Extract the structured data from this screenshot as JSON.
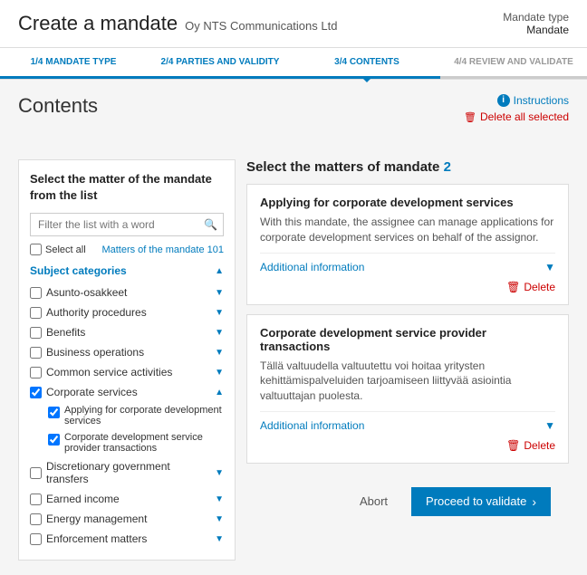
{
  "header": {
    "title": "Create a mandate",
    "company": "Oy NTS Communications Ltd",
    "mandate_type_label": "Mandate type",
    "mandate_type_value": "Mandate"
  },
  "progress": {
    "steps": [
      {
        "id": "step1",
        "label": "1/4 MANDATE TYPE",
        "state": "done"
      },
      {
        "id": "step2",
        "label": "2/4 PARTIES AND VALIDITY",
        "state": "done"
      },
      {
        "id": "step3",
        "label": "3/4 CONTENTS",
        "state": "active"
      },
      {
        "id": "step4",
        "label": "4/4 REVIEW AND VALIDATE",
        "state": "inactive"
      }
    ]
  },
  "page": {
    "title": "Contents",
    "instructions_label": "Instructions",
    "delete_all_label": "Delete all selected"
  },
  "left_panel": {
    "title": "Select the matter of the mandate from the list",
    "search_placeholder": "Filter the list with a word",
    "select_all_label": "Select all",
    "matters_label": "Matters of the mandate",
    "matters_count": "101",
    "subject_categories_label": "Subject categories",
    "items": [
      {
        "id": "asunto",
        "label": "Asunto-osakkeet",
        "checked": false,
        "expanded": false
      },
      {
        "id": "authority",
        "label": "Authority procedures",
        "checked": false,
        "expanded": false
      },
      {
        "id": "benefits",
        "label": "Benefits",
        "checked": false,
        "expanded": false
      },
      {
        "id": "business",
        "label": "Business operations",
        "checked": false,
        "expanded": false
      },
      {
        "id": "common",
        "label": "Common service activities",
        "checked": false,
        "expanded": false
      },
      {
        "id": "corporate",
        "label": "Corporate services",
        "checked": true,
        "expanded": true,
        "subitems": [
          {
            "id": "corporate_dev",
            "label": "Applying for corporate development services",
            "checked": true
          },
          {
            "id": "corporate_provider",
            "label": "Corporate development service provider transactions",
            "checked": true
          }
        ]
      },
      {
        "id": "discretionary",
        "label": "Discretionary government transfers",
        "checked": false,
        "expanded": false
      },
      {
        "id": "earned",
        "label": "Earned income",
        "checked": false,
        "expanded": false
      },
      {
        "id": "energy",
        "label": "Energy management",
        "checked": false,
        "expanded": false
      },
      {
        "id": "enforcement",
        "label": "Enforcement matters",
        "checked": false,
        "expanded": false
      }
    ]
  },
  "right_panel": {
    "title": "Select the matters of mandate",
    "count": "2",
    "cards": [
      {
        "id": "card1",
        "title": "Applying for corporate development services",
        "description": "With this mandate, the assignee can manage applications for corporate development services on behalf of the assignor.",
        "additional_info_label": "Additional information",
        "delete_label": "Delete"
      },
      {
        "id": "card2",
        "title": "Corporate development service provider transactions",
        "description": "Tällä valtuudella valtuutettu voi hoitaa yritysten kehittämispalveluiden tarjoamiseen liittyvää asiointia valtuuttajan puolesta.",
        "additional_info_label": "Additional information",
        "delete_label": "Delete"
      }
    ]
  },
  "footer": {
    "abort_label": "Abort",
    "proceed_label": "Proceed to validate"
  }
}
